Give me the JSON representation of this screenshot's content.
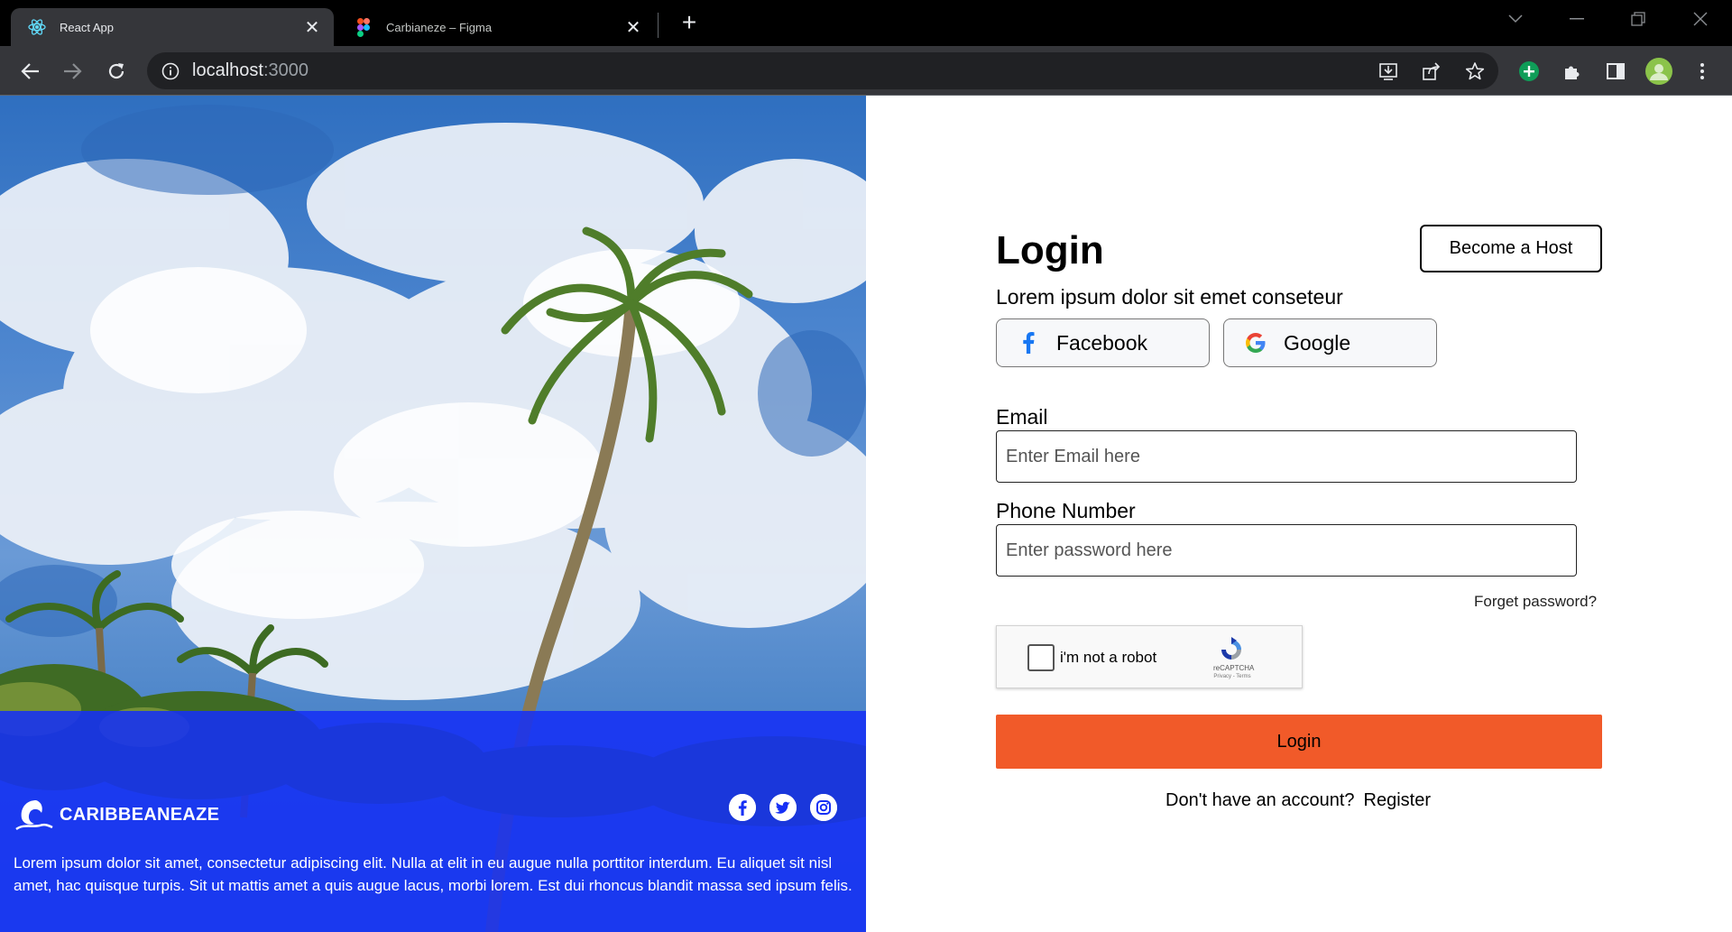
{
  "browser": {
    "tabs": [
      {
        "title": "React App",
        "icon": "react-icon",
        "active": true
      },
      {
        "title": "Carbianeze – Figma",
        "icon": "figma-icon",
        "active": false
      }
    ],
    "url_host": "localhost",
    "url_port": ":3000"
  },
  "hero": {
    "brand_name": "CARIBBEANEAZE",
    "description": "Lorem ipsum dolor sit amet, consectetur adipiscing elit. Nulla at elit in eu augue nulla porttitor interdum. Eu aliquet sit nisl amet, hac quisque turpis. Sit ut mattis amet a quis augue lacus, morbi lorem. Est dui rhoncus blandit massa sed ipsum felis.",
    "socials": [
      "facebook-icon",
      "twitter-icon",
      "instagram-icon"
    ],
    "overlay_color": "#1630f5"
  },
  "login": {
    "title": "Login",
    "host_button": "Become a Host",
    "subtitle": "Lorem ipsum dolor sit emet conseteur",
    "facebook_label": "Facebook",
    "google_label": "Google",
    "email_label": "Email",
    "email_placeholder": "Enter Email here",
    "phone_label": "Phone Number",
    "phone_placeholder": "Enter password here",
    "forgot_label": "Forget password?",
    "captcha_label": "i'm not a robot",
    "captcha_brand": "reCAPTCHA",
    "captcha_terms": "Privacy - Terms",
    "submit_label": "Login",
    "register_prompt": "Don't have an account?",
    "register_link": "Register",
    "accent_color": "#f15a29"
  }
}
